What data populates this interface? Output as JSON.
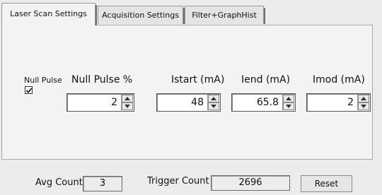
{
  "tabs": [
    {
      "label": "Laser Scan Settings",
      "active": true
    },
    {
      "label": "Acquisition Settings",
      "active": false
    },
    {
      "label": "Filter+GraphHist",
      "active": false
    }
  ],
  "null_pulse": {
    "label": "Null Pulse",
    "checked": true
  },
  "fields": [
    {
      "label": "Null Pulse %",
      "value": "2"
    },
    {
      "label": "Istart (mA)",
      "value": "48"
    },
    {
      "label": "Iend (mA)",
      "value": "65.8"
    },
    {
      "label": "Imod (mA)",
      "value": "2"
    }
  ],
  "footer": {
    "avg_count_label": "Avg Count",
    "avg_count_value": "3",
    "trigger_count_label": "Trigger Count",
    "trigger_count_value": "2696",
    "reset_label": "Reset"
  }
}
